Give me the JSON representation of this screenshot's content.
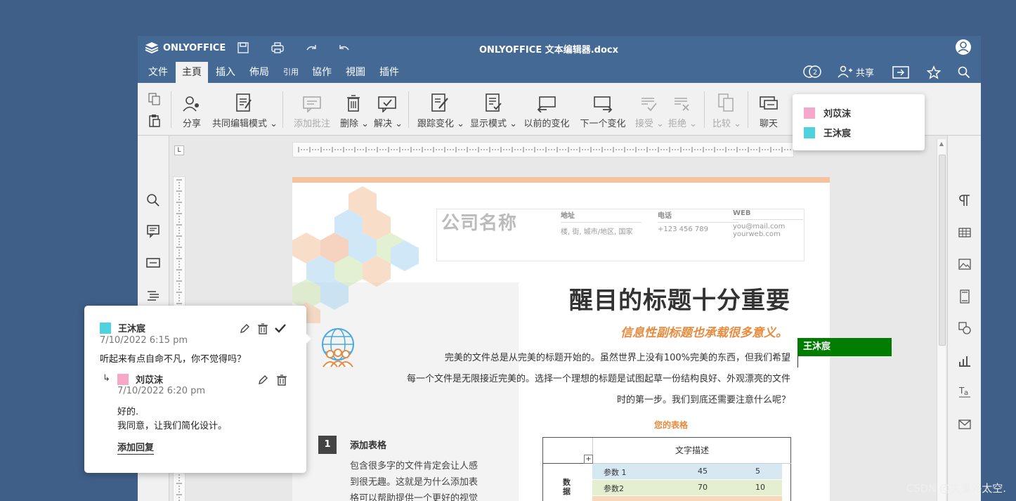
{
  "app": {
    "name": "ONLYOFFICE",
    "doc_title": "ONLYOFFICE 文本编辑器.docx"
  },
  "menu": {
    "tabs": [
      {
        "label": "文件"
      },
      {
        "label": "主頁"
      },
      {
        "label": "插入"
      },
      {
        "label": "佈局"
      },
      {
        "label": "引用"
      },
      {
        "label": "協作"
      },
      {
        "label": "視圖"
      },
      {
        "label": "插件"
      }
    ],
    "users_count": "2",
    "share_label": "共享"
  },
  "toolbar": {
    "share": "分享",
    "coedit": "共同编辑模式",
    "add_comment": "添加批注",
    "delete": "删除",
    "resolve": "解决",
    "track": "跟踪变化",
    "display": "显示模式",
    "prev_change": "以前的变化",
    "next_change": "下一个变化",
    "accept": "接受",
    "reject": "拒绝",
    "compare": "比较",
    "chat": "聊天"
  },
  "share_popup": {
    "users": [
      {
        "name": "刘苡沫",
        "color": "#f7a8c9"
      },
      {
        "name": "王沐宸",
        "color": "#4fd2e0"
      }
    ]
  },
  "document": {
    "company": "公司名称",
    "contact": [
      {
        "head": "地址",
        "lines": [
          "楼, 街, 城市/地区, 国家"
        ]
      },
      {
        "head": "电话",
        "lines": [
          "+123 456 789"
        ]
      },
      {
        "head": "WEB",
        "lines": [
          "you@mail.com",
          "yourweb.com"
        ]
      }
    ],
    "title": "醒目的标题十分重要",
    "subtitle": "信息性副标题也承载很多意义。",
    "para": [
      "完美的文件总是从完美的标题开始的。虽然世界上没有100%完美的东西，但我们希望",
      "每一个文件是无限接近完美的。选择一个理想的标题是试图起草一份结构良好、外观漂亮的文件",
      "时的第一步。我们到底还需要注意什么呢？"
    ],
    "table_caption": "您的表格",
    "section_num": "1",
    "section_title": "添加表格",
    "section_body": [
      "包含很多字的文件肯定会让人感",
      "到很无趣。这就是为什么添加表",
      "格可以帮助提供一个更好的视觉"
    ],
    "table": {
      "header": "文字描述",
      "side": "数据",
      "rows": [
        [
          "参数 1",
          "45",
          "5"
        ],
        [
          "参数2",
          "70",
          "10"
        ]
      ]
    }
  },
  "cursor_user": "王沐宸",
  "comment": {
    "author": "王沐宸",
    "author_color": "#4fd2e0",
    "date": "7/10/2022  6:15 pm",
    "text": "听起来有点自命不凡，你不觉得吗？",
    "reply": {
      "author": "刘苡沫",
      "author_color": "#f7a8c9",
      "date": "7/10/2022  6:20 pm",
      "lines": [
        "好的.",
        "我同意，让我们简化设计。"
      ]
    },
    "add_reply": "添加回复"
  },
  "watermark": "CSDN @失重外太空."
}
